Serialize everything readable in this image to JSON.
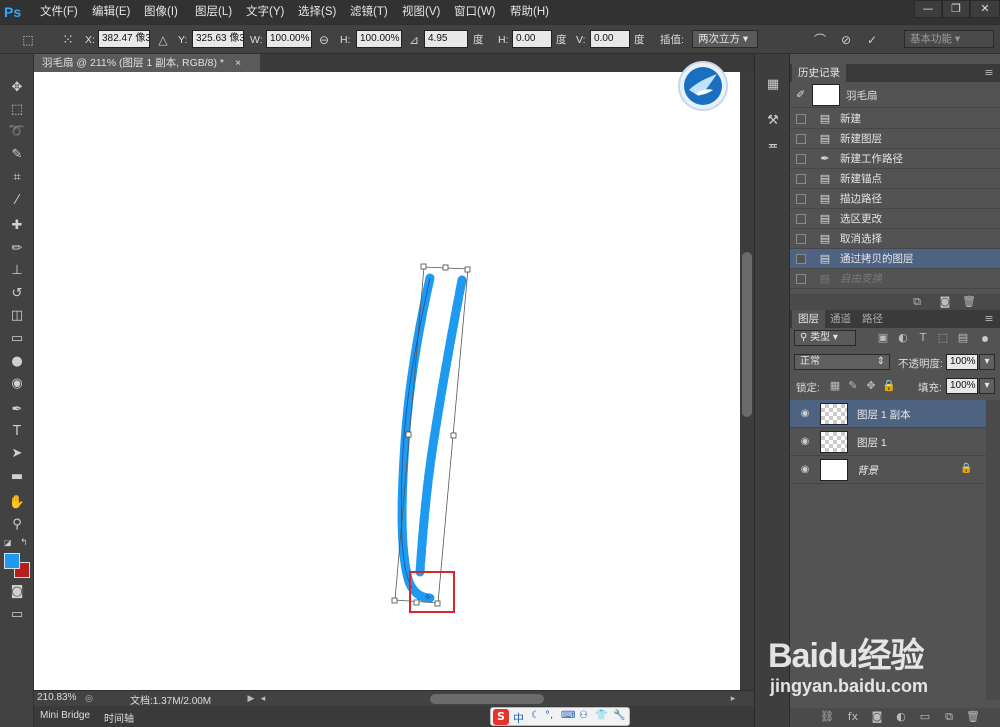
{
  "app": {
    "logo": "Ps"
  },
  "menu": [
    "文件(F)",
    "编辑(E)",
    "图像(I)",
    "图层(L)",
    "文字(Y)",
    "选择(S)",
    "滤镜(T)",
    "视图(V)",
    "窗口(W)",
    "帮助(H)"
  ],
  "window_controls": [
    "—",
    "❐",
    "✕"
  ],
  "options": {
    "x_label": "X:",
    "x_value": "382.47 像3",
    "y_label": "Y:",
    "y_value": "325.63 像3",
    "w_label": "W:",
    "w_value": "100.00%",
    "h_label": "H:",
    "h_value": "100.00%",
    "angle_value": "4.95",
    "angle_unit": "度",
    "hskew_label": "H:",
    "hskew_value": "0.00",
    "hskew_unit": "度",
    "vskew_label": "V:",
    "vskew_value": "0.00",
    "vskew_unit": "度",
    "interp_label": "插值:",
    "interp_value": "两次立方",
    "workspace": "基本功能"
  },
  "document": {
    "tab_title": "羽毛扇 @ 211% (图层 1 副本, RGB/8) *",
    "zoom": "210.83%",
    "doc_size": "文档:1.37M/2.00M"
  },
  "bottom_tabs": [
    "Mini Bridge",
    "时间轴"
  ],
  "history": {
    "title": "历史记录",
    "snapshot": "羽毛扇",
    "items": [
      {
        "label": "新建",
        "icon": "doc-icon"
      },
      {
        "label": "新建图层",
        "icon": "doc-icon"
      },
      {
        "label": "新建工作路径",
        "icon": "pen-icon"
      },
      {
        "label": "新建锚点",
        "icon": "doc-icon"
      },
      {
        "label": "描边路径",
        "icon": "doc-icon"
      },
      {
        "label": "选区更改",
        "icon": "doc-icon"
      },
      {
        "label": "取消选择",
        "icon": "doc-icon"
      },
      {
        "label": "通过拷贝的图层",
        "icon": "doc-icon"
      },
      {
        "label": "自由变换",
        "icon": "doc-icon"
      }
    ]
  },
  "layers": {
    "tabs": [
      "图层",
      "通道",
      "路径"
    ],
    "filter_kind": "类型",
    "blend_mode": "正常",
    "opacity_label": "不透明度:",
    "opacity_value": "100%",
    "lock_label": "锁定:",
    "fill_label": "填充:",
    "fill_value": "100%",
    "items": [
      {
        "name": "图层 1 副本"
      },
      {
        "name": "图层 1"
      },
      {
        "name": "背景"
      }
    ]
  },
  "ime": {
    "label": "中"
  },
  "watermark": {
    "brand": "Baidu经验",
    "url": "jingyan.baidu.com"
  },
  "colors": {
    "stroke": "#1e9bf0",
    "selection": "#4e6382",
    "highlight_box": "#d9252b"
  }
}
